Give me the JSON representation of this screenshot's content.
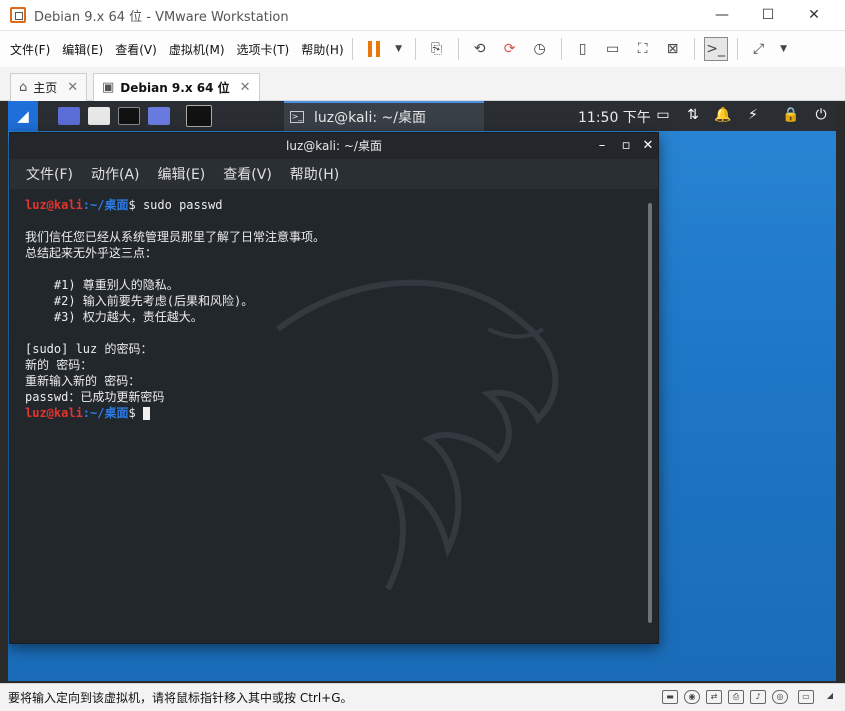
{
  "window": {
    "title": "Debian 9.x 64 位 - VMware Workstation",
    "minimize": "—",
    "maximize": "☐",
    "close": "✕"
  },
  "menu": [
    "文件(F)",
    "编辑(E)",
    "查看(V)",
    "虚拟机(M)",
    "选项卡(T)",
    "帮助(H)"
  ],
  "tabs": [
    {
      "label": "主页",
      "icon": "home-icon"
    },
    {
      "label": "Debian 9.x 64 位",
      "icon": "vm-icon"
    }
  ],
  "kali_panel": {
    "task_title": "luz@kali: ~/桌面",
    "clock": "11:50 下午"
  },
  "terminal": {
    "title": "luz@kali: ~/桌面",
    "menu": [
      "文件(F)",
      "动作(A)",
      "编辑(E)",
      "查看(V)",
      "帮助(H)"
    ],
    "prompt_user": "luz@kali",
    "prompt_path": ":~/桌面",
    "prompt_symbol": "$",
    "command": " sudo passwd",
    "lines": [
      "我们信任您已经从系统管理员那里了解了日常注意事项。",
      "总结起来无外乎这三点：",
      "",
      "    #1) 尊重别人的隐私。",
      "    #2) 输入前要先考虑(后果和风险)。",
      "    #3) 权力越大，责任越大。",
      "",
      "[sudo] luz 的密码：",
      "新的 密码：",
      "重新输入新的 密码：",
      "passwd：已成功更新密码"
    ]
  },
  "statusbar": {
    "text": "要将输入定向到该虚拟机，请将鼠标指针移入其中或按 Ctrl+G。"
  },
  "colors": {
    "accent": "#e8760f",
    "prompt_user": "#e0342e",
    "prompt_path": "#2c7be5",
    "desktop": "#1f78c8"
  }
}
